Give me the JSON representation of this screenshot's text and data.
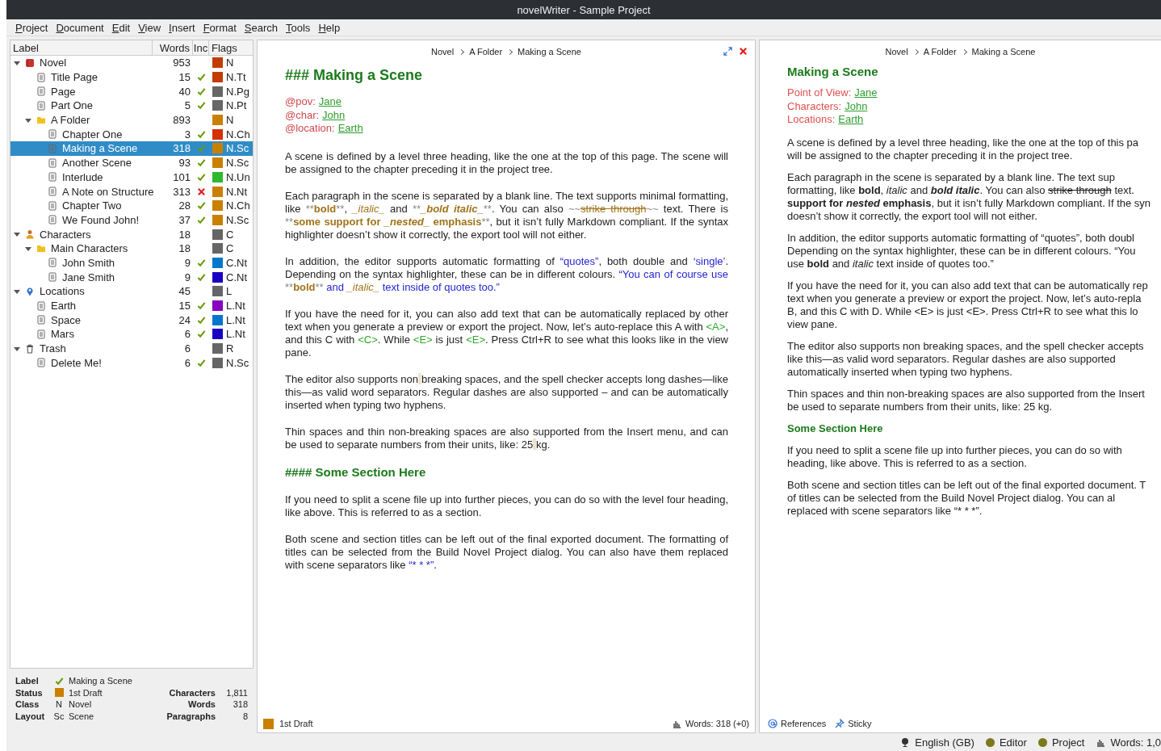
{
  "window": {
    "title": "novelWriter - Sample Project"
  },
  "menu": [
    "Project",
    "Document",
    "Edit",
    "View",
    "Insert",
    "Format",
    "Search",
    "Tools",
    "Help"
  ],
  "tree": {
    "columns": [
      "Label",
      "Words",
      "Inc",
      "Flags"
    ],
    "items": [
      {
        "label": "Novel",
        "kind": "novel",
        "words": "953",
        "flag": "N",
        "color": "#c23c00",
        "expanded": true,
        "selected": false,
        "children": [
          {
            "label": "Title Page",
            "kind": "file",
            "words": "15",
            "included": true,
            "flag": "N.Tt",
            "color": "#c23c00",
            "selected": false
          },
          {
            "label": "Page",
            "kind": "file",
            "words": "40",
            "included": true,
            "flag": "N.Pg",
            "color": "#666666",
            "selected": false
          },
          {
            "label": "Part One",
            "kind": "file",
            "words": "5",
            "included": true,
            "flag": "N.Pt",
            "color": "#666666",
            "selected": false
          },
          {
            "label": "A Folder",
            "kind": "folder",
            "words": "893",
            "flag": "N",
            "color": "#c98000",
            "expanded": true,
            "selected": false,
            "children": [
              {
                "label": "Chapter One",
                "kind": "file",
                "words": "3",
                "included": true,
                "flag": "N.Ch",
                "color": "#d43000",
                "selected": false
              },
              {
                "label": "Making a Scene",
                "kind": "file",
                "words": "318",
                "included": true,
                "flag": "N.Sc",
                "color": "#c98000",
                "selected": true
              },
              {
                "label": "Another Scene",
                "kind": "file",
                "words": "93",
                "included": true,
                "flag": "N.Sc",
                "color": "#c98000",
                "selected": false
              },
              {
                "label": "Interlude",
                "kind": "file",
                "words": "101",
                "included": true,
                "flag": "N.Un",
                "color": "#2eb82e",
                "selected": false
              },
              {
                "label": "A Note on Structure",
                "kind": "file",
                "words": "313",
                "included": false,
                "flag": "N.Nt",
                "color": "#c98000",
                "selected": false
              },
              {
                "label": "Chapter Two",
                "kind": "file",
                "words": "28",
                "included": true,
                "flag": "N.Ch",
                "color": "#c98000",
                "selected": false
              },
              {
                "label": "We Found John!",
                "kind": "file",
                "words": "37",
                "included": true,
                "flag": "N.Sc",
                "color": "#c98000",
                "selected": false
              }
            ]
          }
        ]
      },
      {
        "label": "Characters",
        "kind": "characters",
        "words": "18",
        "flag": "C",
        "color": "#666666",
        "expanded": true,
        "selected": false,
        "children": [
          {
            "label": "Main Characters",
            "kind": "folder",
            "words": "18",
            "flag": "C",
            "color": "#666666",
            "expanded": true,
            "selected": false,
            "children": [
              {
                "label": "John Smith",
                "kind": "file",
                "words": "9",
                "included": true,
                "flag": "C.Nt",
                "color": "#0077cc",
                "selected": false
              },
              {
                "label": "Jane Smith",
                "kind": "file",
                "words": "9",
                "included": true,
                "flag": "C.Nt",
                "color": "#1a00c0",
                "selected": false
              }
            ]
          }
        ]
      },
      {
        "label": "Locations",
        "kind": "locations",
        "words": "45",
        "flag": "L",
        "color": "#666666",
        "expanded": true,
        "selected": false,
        "children": [
          {
            "label": "Earth",
            "kind": "file",
            "words": "15",
            "included": true,
            "flag": "L.Nt",
            "color": "#8800c0",
            "selected": false
          },
          {
            "label": "Space",
            "kind": "file",
            "words": "24",
            "included": true,
            "flag": "L.Nt",
            "color": "#0077cc",
            "selected": false
          },
          {
            "label": "Mars",
            "kind": "file",
            "words": "6",
            "included": true,
            "flag": "L.Nt",
            "color": "#1a00c0",
            "selected": false
          }
        ]
      },
      {
        "label": "Trash",
        "kind": "trash",
        "words": "6",
        "flag": "R",
        "color": "#666666",
        "expanded": true,
        "selected": false,
        "children": [
          {
            "label": "Delete Me!",
            "kind": "file",
            "words": "6",
            "included": true,
            "flag": "N.Sc",
            "color": "#666666",
            "selected": false
          }
        ]
      }
    ]
  },
  "details": {
    "left": [
      {
        "label": "Label",
        "kind": "check",
        "value": "Making a Scene"
      },
      {
        "label": "Status",
        "kind": "swatch",
        "color": "#c98000",
        "value": "1st Draft"
      },
      {
        "label": "Class",
        "kind": "code",
        "code": "N",
        "value": "Novel"
      },
      {
        "label": "Layout",
        "kind": "code",
        "code": "Sc",
        "value": "Scene"
      }
    ],
    "right": [
      {
        "label": "Characters",
        "value": "1,811"
      },
      {
        "label": "Words",
        "value": "318"
      },
      {
        "label": "Paragraphs",
        "value": "8"
      }
    ]
  },
  "editor": {
    "breadcrumb": [
      "Novel",
      "A Folder",
      "Making a Scene"
    ],
    "heading": "### Making a Scene",
    "tags": [
      {
        "keyword": "@pov:",
        "value": "Jane"
      },
      {
        "keyword": "@char:",
        "value": "John"
      },
      {
        "keyword": "@location:",
        "value": "Earth"
      }
    ],
    "blocks": [
      {
        "kind": "para",
        "segments": [
          {
            "kind": "plain",
            "text": "A scene is defined by a level three heading, like the one at the top of this page. The scene will be assigned to the chapter preceding it in the project tree."
          }
        ]
      },
      {
        "kind": "para",
        "segments": [
          {
            "kind": "plain",
            "text": "Each paragraph in the scene is separated by a blank line. The text supports minimal formatting, like "
          },
          {
            "kind": "markup",
            "text": "**"
          },
          {
            "kind": "bold",
            "text": "bold"
          },
          {
            "kind": "markup",
            "text": "**"
          },
          {
            "kind": "plain",
            "text": ", "
          },
          {
            "kind": "italic",
            "text": "_italic_"
          },
          {
            "kind": "plain",
            "text": " and  "
          },
          {
            "kind": "markup",
            "text": "**"
          },
          {
            "kind": "bolditalic",
            "text": "_bold italic_"
          },
          {
            "kind": "markup",
            "text": "**"
          },
          {
            "kind": "plain",
            "text": ". You can also "
          },
          {
            "kind": "markup",
            "text": "~~"
          },
          {
            "kind": "strike",
            "text": "strike through"
          },
          {
            "kind": "markup",
            "text": "~~"
          },
          {
            "kind": "plain",
            "text": " text. There is "
          },
          {
            "kind": "markup",
            "text": "**"
          },
          {
            "kind": "bold",
            "text": "some support for "
          },
          {
            "kind": "bolditalic",
            "text": "_nested_"
          },
          {
            "kind": "bold",
            "text": " emphasis"
          },
          {
            "kind": "markup",
            "text": "**"
          },
          {
            "kind": "plain",
            "text": ", but it isn’t fully Markdown compliant. If the syntax highlighter doesn’t show it correctly, the export tool will not either."
          }
        ]
      },
      {
        "kind": "para",
        "segments": [
          {
            "kind": "plain",
            "text": "In addition, the editor supports automatic formatting of "
          },
          {
            "kind": "quote",
            "text": "“quotes”"
          },
          {
            "kind": "plain",
            "text": ", both double and "
          },
          {
            "kind": "quote",
            "text": "‘single’"
          },
          {
            "kind": "plain",
            "text": ". Depending on the syntax highlighter, these can be in different colours. "
          },
          {
            "kind": "quote",
            "text": "“You can of course use "
          },
          {
            "kind": "markup",
            "text": "**"
          },
          {
            "kind": "bold",
            "text": "bold"
          },
          {
            "kind": "markup",
            "text": "**"
          },
          {
            "kind": "quote",
            "text": " and "
          },
          {
            "kind": "italic",
            "text": "_italic_"
          },
          {
            "kind": "quote",
            "text": " text inside of quotes too.”"
          }
        ]
      },
      {
        "kind": "para",
        "segments": [
          {
            "kind": "plain",
            "text": "If you have the need for it, you can also add text that can be automatically replaced by other text when you generate a preview or export the project. Now, let’s auto-replace this A with "
          },
          {
            "kind": "replace",
            "text": "<A>"
          },
          {
            "kind": "plain",
            "text": ", and this C with "
          },
          {
            "kind": "replace",
            "text": "<C>"
          },
          {
            "kind": "plain",
            "text": ".  While "
          },
          {
            "kind": "replace",
            "text": "<E>"
          },
          {
            "kind": "plain",
            "text": " is just "
          },
          {
            "kind": "replace",
            "text": "<E>"
          },
          {
            "kind": "plain",
            "text": ". Press Ctrl+R to see what this looks like in the view pane."
          }
        ]
      },
      {
        "kind": "para",
        "segments": [
          {
            "kind": "plain",
            "text": "The editor also supports non"
          },
          {
            "kind": "nbsp"
          },
          {
            "kind": "plain",
            "text": "breaking spaces, and the spell checker accepts long dashes—like this—as valid word separators. Regular dashes are also supported – and can be automatically inserted when typing two hyphens."
          }
        ]
      },
      {
        "kind": "para",
        "segments": [
          {
            "kind": "plain",
            "text": "Thin spaces and thin non-breaking spaces are also supported from the Insert menu, and can be used to separate numbers from their units, like: 25"
          },
          {
            "kind": "nbsp"
          },
          {
            "kind": "plain",
            "text": "kg."
          }
        ]
      },
      {
        "kind": "heading",
        "text": "#### Some Section Here"
      },
      {
        "kind": "para",
        "segments": [
          {
            "kind": "plain",
            "text": "If you need to split a scene file up into further pieces, you can do so with the level four heading, like above. This is referred to as a section."
          }
        ]
      },
      {
        "kind": "para",
        "segments": [
          {
            "kind": "plain",
            "text": "Both scene and section titles can be left out of the final exported document. The formatting of titles can be selected from the Build Novel Project dialog. You can also have them replaced with scene separators like "
          },
          {
            "kind": "quote",
            "text": "“* * *”"
          },
          {
            "kind": "plain",
            "text": "."
          }
        ]
      }
    ],
    "status": {
      "label": "1st Draft",
      "color": "#c98000"
    },
    "words": "Words: 318 (+0)"
  },
  "viewer": {
    "breadcrumb": [
      "Novel",
      "A Folder",
      "Making a Scene"
    ],
    "heading": "Making a Scene",
    "tags": [
      {
        "label": "Point of View:",
        "value": "Jane"
      },
      {
        "label": "Characters:",
        "value": "John"
      },
      {
        "label": "Locations:",
        "value": "Earth"
      }
    ],
    "blocks": [
      {
        "kind": "para",
        "lines": [
          [
            {
              "kind": "plain",
              "text": "A scene is defined by a level three heading, like the one at the top of this pa"
            }
          ],
          [
            {
              "kind": "plain",
              "text": "will be assigned to the chapter preceding it in the project tree."
            }
          ]
        ]
      },
      {
        "kind": "para",
        "lines": [
          [
            {
              "kind": "plain",
              "text": "Each paragraph in the scene is separated by a blank line. The text sup"
            }
          ],
          [
            {
              "kind": "plain",
              "text": "formatting, like "
            },
            {
              "kind": "bold",
              "text": "bold"
            },
            {
              "kind": "plain",
              "text": ", "
            },
            {
              "kind": "italic",
              "text": "italic"
            },
            {
              "kind": "plain",
              "text": " and "
            },
            {
              "kind": "bolditalic",
              "text": "bold italic"
            },
            {
              "kind": "plain",
              "text": ". You can also "
            },
            {
              "kind": "strike",
              "text": "strike through"
            },
            {
              "kind": "plain",
              "text": " text."
            }
          ],
          [
            {
              "kind": "bold",
              "text": "support for "
            },
            {
              "kind": "bolditalic",
              "text": "nested"
            },
            {
              "kind": "bold",
              "text": " emphasis"
            },
            {
              "kind": "plain",
              "text": ", but it isn’t fully Markdown compliant. If the syn"
            }
          ],
          [
            {
              "kind": "plain",
              "text": "doesn’t show it correctly, the export tool will not either."
            }
          ]
        ]
      },
      {
        "kind": "para",
        "lines": [
          [
            {
              "kind": "plain",
              "text": "In addition, the editor supports automatic formatting of “quotes”, both doubl"
            }
          ],
          [
            {
              "kind": "plain",
              "text": "Depending on the syntax highlighter, these can be in different colours. “You"
            }
          ],
          [
            {
              "kind": "plain",
              "text": "use "
            },
            {
              "kind": "bold",
              "text": "bold"
            },
            {
              "kind": "plain",
              "text": " and "
            },
            {
              "kind": "italic",
              "text": "italic"
            },
            {
              "kind": "plain",
              "text": " text inside of quotes too.”"
            }
          ]
        ]
      },
      {
        "kind": "para",
        "lines": [
          [
            {
              "kind": "plain",
              "text": "If you have the need for it, you can also add text that can be automatically rep"
            }
          ],
          [
            {
              "kind": "plain",
              "text": "text when you generate a preview or export the project. Now, let’s auto-repla"
            }
          ],
          [
            {
              "kind": "plain",
              "text": "B, and this C with D. While <E> is just <E>. Press Ctrl+R to see what this lo"
            }
          ],
          [
            {
              "kind": "plain",
              "text": "view pane."
            }
          ]
        ]
      },
      {
        "kind": "para",
        "lines": [
          [
            {
              "kind": "plain",
              "text": "The editor also supports non breaking spaces, and the spell checker accepts"
            }
          ],
          [
            {
              "kind": "plain",
              "text": "like this—as valid word separators. Regular dashes are also supported"
            }
          ],
          [
            {
              "kind": "plain",
              "text": "automatically inserted when typing two hyphens."
            }
          ]
        ]
      },
      {
        "kind": "para",
        "lines": [
          [
            {
              "kind": "plain",
              "text": "Thin spaces and thin non-breaking spaces are also supported from the Insert"
            }
          ],
          [
            {
              "kind": "plain",
              "text": "be used to separate numbers from their units, like: 25 kg."
            }
          ]
        ]
      },
      {
        "kind": "heading",
        "text": "Some Section Here"
      },
      {
        "kind": "para",
        "lines": [
          [
            {
              "kind": "plain",
              "text": "If you need to split a scene file up into further pieces, you can do so with"
            }
          ],
          [
            {
              "kind": "plain",
              "text": "heading, like above. This is referred to as a section."
            }
          ]
        ]
      },
      {
        "kind": "para",
        "lines": [
          [
            {
              "kind": "plain",
              "text": "Both scene and section titles can be left out of the final exported document. T"
            }
          ],
          [
            {
              "kind": "plain",
              "text": "of titles can be selected from the Build Novel Project dialog. You can al"
            }
          ],
          [
            {
              "kind": "plain",
              "text": "replaced with scene separators like “* * *”."
            }
          ]
        ]
      }
    ],
    "buttons": [
      {
        "kind": "references",
        "label": "References"
      },
      {
        "kind": "sticky",
        "label": "Sticky"
      }
    ]
  },
  "status_bar": [
    {
      "kind": "language",
      "label": "English (GB)"
    },
    {
      "kind": "dot",
      "label": "Editor",
      "color": "#7a7a1e"
    },
    {
      "kind": "dot",
      "label": "Project",
      "color": "#7a7a1e"
    },
    {
      "kind": "words",
      "label": "Words: 1,0"
    }
  ]
}
